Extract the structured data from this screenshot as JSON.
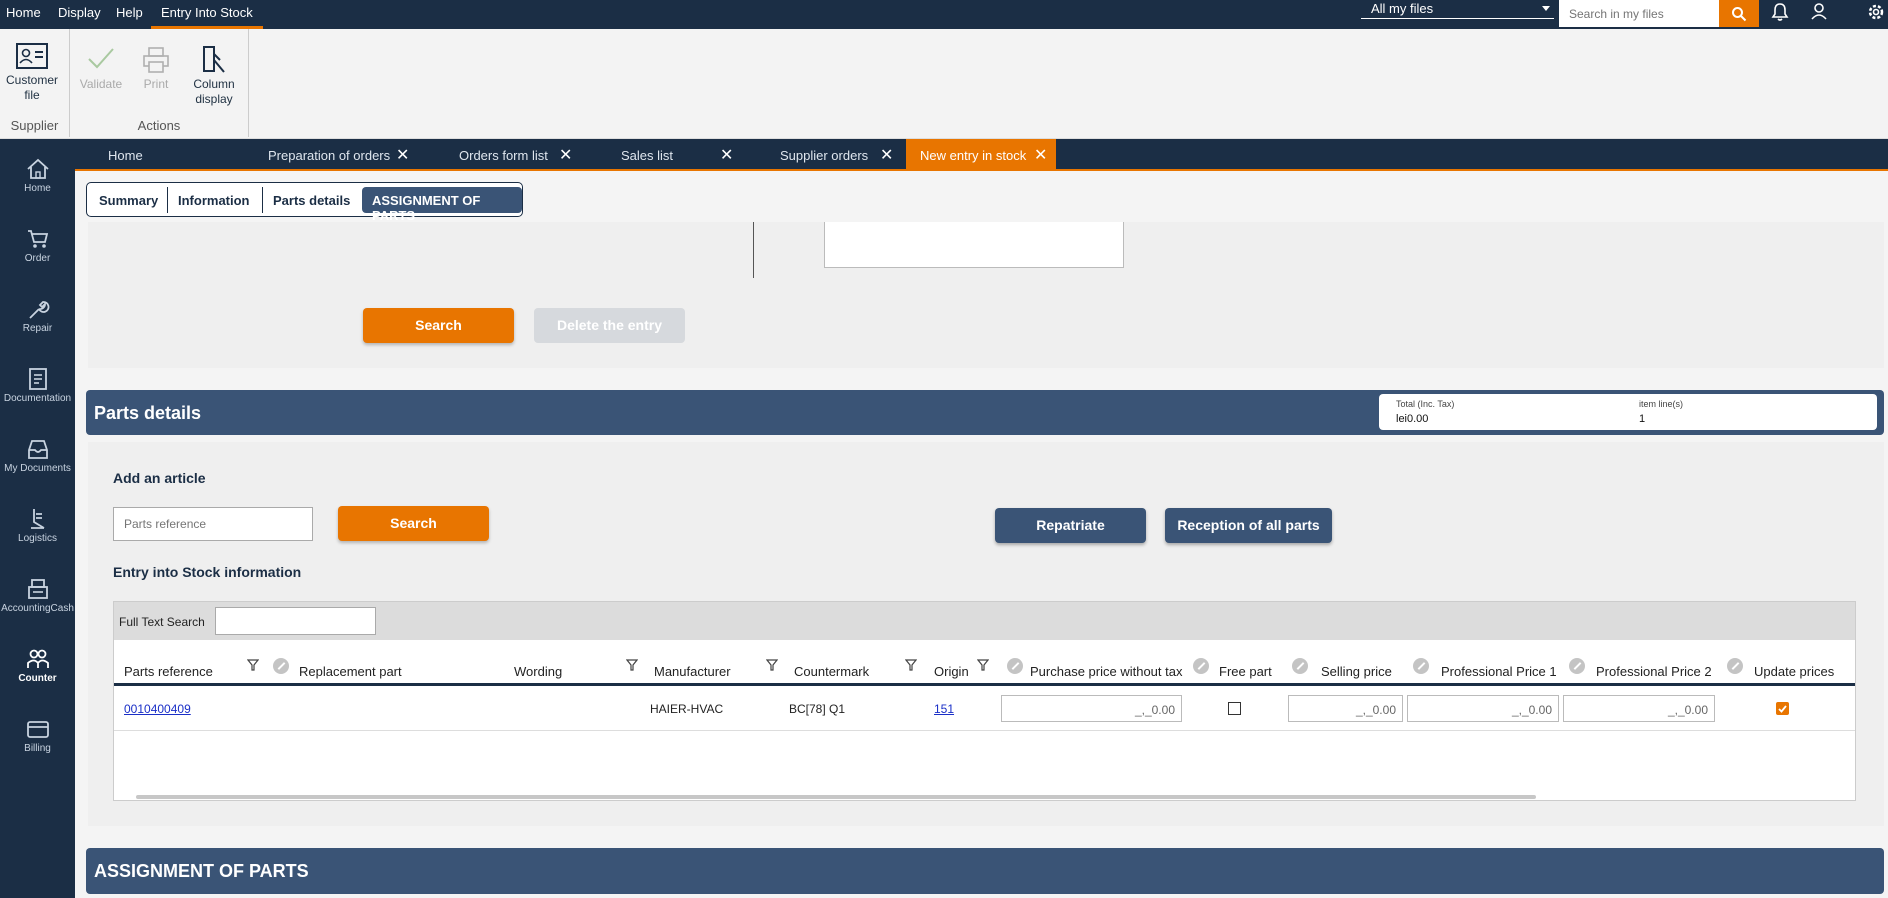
{
  "menubar": {
    "items": [
      "Home",
      "Display",
      "Help"
    ],
    "active": "Entry Into Stock",
    "files_select": "All my files",
    "search_placeholder": "Search in my files"
  },
  "ribbon": {
    "supplier_group": {
      "button": "Customer file",
      "caption": "Supplier"
    },
    "actions_group": {
      "validate": "Validate",
      "print": "Print",
      "column_display": "Column display",
      "caption": "Actions"
    }
  },
  "sidebar": {
    "items": [
      {
        "label": "Home",
        "icon": "home-icon"
      },
      {
        "label": "Order",
        "icon": "cart-icon"
      },
      {
        "label": "Repair",
        "icon": "wrench-icon"
      },
      {
        "label": "Documentation",
        "icon": "document-icon"
      },
      {
        "label": "My Documents",
        "icon": "inbox-icon"
      },
      {
        "label": "Logistics",
        "icon": "logistics-icon"
      },
      {
        "label": "AccountingCash",
        "icon": "cash-register-icon"
      },
      {
        "label": "Counter",
        "icon": "people-icon"
      },
      {
        "label": "Billing",
        "icon": "wallet-icon"
      }
    ]
  },
  "doc_tabs": [
    {
      "label": "Home"
    },
    {
      "label": "Preparation of orders"
    },
    {
      "label": "Orders form list"
    },
    {
      "label": "Sales list"
    },
    {
      "label": "Supplier orders"
    },
    {
      "label": "New entry in stock"
    }
  ],
  "subtabs": [
    "Summary",
    "Information",
    "Parts details",
    "ASSIGNMENT OF PARTS"
  ],
  "upper": {
    "search_label": "Search",
    "delete_label": "Delete the entry"
  },
  "parts_details": {
    "title": "Parts details",
    "total_label": "Total (Inc. Tax)",
    "total_value": "lei0.00",
    "lines_label": "item line(s)",
    "lines_value": "1",
    "add_article": "Add an article",
    "parts_ref_placeholder": "Parts reference",
    "search_label": "Search",
    "repatriate_label": "Repatriate",
    "reception_label": "Reception of all parts",
    "entry_info_heading": "Entry into Stock information",
    "full_text_search": "Full Text Search"
  },
  "grid": {
    "columns": [
      "Parts reference",
      "Replacement part",
      "Wording",
      "Manufacturer",
      "Countermark",
      "Origin",
      "Purchase price without tax",
      "Free part",
      "Selling price",
      "Professional Price 1",
      "Professional Price 2",
      "Update prices"
    ],
    "rows": [
      {
        "parts_reference": "0010400409",
        "replacement_part": "",
        "wording": "",
        "manufacturer": "HAIER-HVAC",
        "countermark": "BC[78] Q1",
        "origin": "151",
        "purchase_price": "_,_0.00",
        "free_part": false,
        "selling_price": "_,_0.00",
        "pro_price_1": "_,_0.00",
        "pro_price_2": "_,_0.00",
        "update_prices": true
      }
    ]
  },
  "assignment": {
    "title": "ASSIGNMENT OF PARTS"
  },
  "colors": {
    "navy": "#1b2e45",
    "accent": "#e87500",
    "header_blue": "#3a5476"
  }
}
